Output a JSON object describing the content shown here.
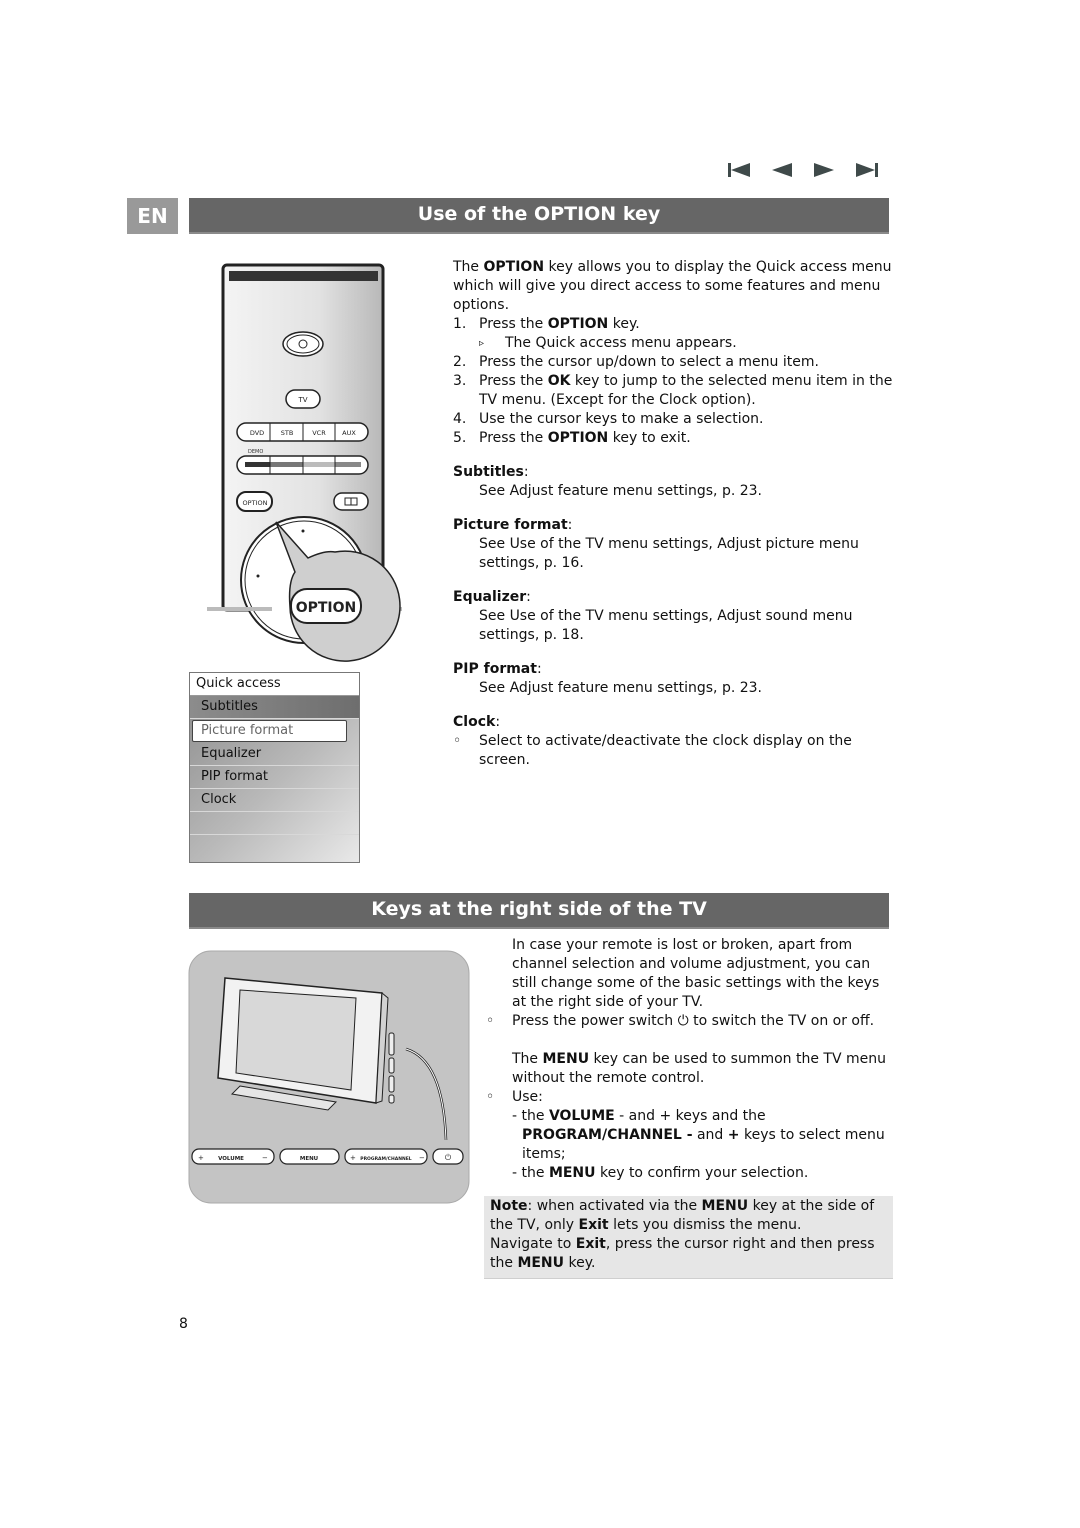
{
  "nav": {
    "icons": [
      "first-page-icon",
      "previous-page-icon",
      "next-page-icon",
      "last-page-icon"
    ]
  },
  "header": {
    "language": "EN",
    "section1_title": "Use of the OPTION key",
    "section2_title": "Keys at the right side of the TV"
  },
  "remote": {
    "tv_label": "TV",
    "source_buttons": [
      "DVD",
      "STB",
      "VCR",
      "AUX"
    ],
    "demo_label": "DEMO",
    "option_small": "OPTION",
    "option_callout": "OPTION",
    "colors": [
      "#333333",
      "#777777",
      "#bbbbbb",
      "#888888"
    ]
  },
  "quick_access": {
    "title": "Quick access",
    "items": [
      "Subtitles",
      "Picture format",
      "Equalizer",
      "PIP format",
      "Clock"
    ],
    "selected_index": 1
  },
  "option_section": {
    "intro_pre": "The ",
    "intro_bold": "OPTION",
    "intro_post": " key allows you to display the Quick access menu which will give you direct access to some features and menu options.",
    "steps": [
      {
        "num": "1.",
        "pre": "Press the ",
        "bold": "OPTION",
        "post": " key."
      },
      {
        "num": "2.",
        "pre": "Press the cursor up/down to select a menu item.",
        "bold": "",
        "post": ""
      },
      {
        "num": "3.",
        "pre": "Press the ",
        "bold": "OK",
        "post": " key to jump to the selected menu item in the TV menu. (Except for the Clock option)."
      },
      {
        "num": "4.",
        "pre": "Use the cursor keys to make a selection.",
        "bold": "",
        "post": ""
      },
      {
        "num": "5.",
        "pre": "Press the ",
        "bold": "OPTION",
        "post": " key to exit."
      }
    ],
    "step1_result_mark": "▹",
    "step1_result": "The Quick access menu appears.",
    "terms": [
      {
        "term": "Subtitles",
        "desc": "See Adjust feature menu settings, p. 23."
      },
      {
        "term": "Picture format",
        "desc": "See Use of the TV menu settings, Adjust picture menu settings, p. 16."
      },
      {
        "term": "Equalizer",
        "desc": "See Use of the TV menu settings, Adjust sound menu settings, p. 18."
      },
      {
        "term": "PIP format",
        "desc": "See Adjust feature menu settings, p. 23."
      },
      {
        "term": "Clock",
        "desc": "Select to activate/deactivate the clock display on the screen."
      }
    ],
    "bullet_mark": "◦"
  },
  "tv_illustration": {
    "buttons": [
      {
        "plus": "+",
        "label": "VOLUME",
        "minus": "−"
      },
      {
        "label": "MENU"
      },
      {
        "plus": "+",
        "label": "PROGRAM/CHANNEL",
        "minus": "−"
      },
      {
        "label": "⏻"
      }
    ]
  },
  "keys_section": {
    "intro": "In case your remote is lost or broken, apart from channel selection and volume adjustment, you can still change some of the basic settings with the keys at the right side of your TV.",
    "power_pre": "Press the power switch ",
    "power_icon": "⏻",
    "power_post": " to switch the TV on or off.",
    "menu_pre": "The ",
    "menu_bold": "MENU",
    "menu_post": " key can be used to summon the TV menu without the remote control.",
    "use_label": "Use:",
    "use1_pre": "- the ",
    "use1_bold": "VOLUME",
    "use1_post": " - and + keys and the",
    "use2_bold1": "PROGRAM/CHANNEL -",
    "use2_mid": " and ",
    "use2_bold2": "+",
    "use2_post": "  keys to select menu items;",
    "use3_pre": "- the ",
    "use3_bold": "MENU",
    "use3_post": " key to confirm your selection."
  },
  "note": {
    "label": "Note",
    "l1_a": ": when activated via the ",
    "l1_b": "MENU",
    "l1_c": " key at the side of the TV, only ",
    "l1_d": "Exit",
    "l1_e": " lets you dismiss the menu.",
    "l2_a": "Navigate to ",
    "l2_b": "Exit",
    "l2_c": ", press the cursor right and then press the ",
    "l2_d": "MENU",
    "l2_e": " key."
  },
  "page_number": "8"
}
